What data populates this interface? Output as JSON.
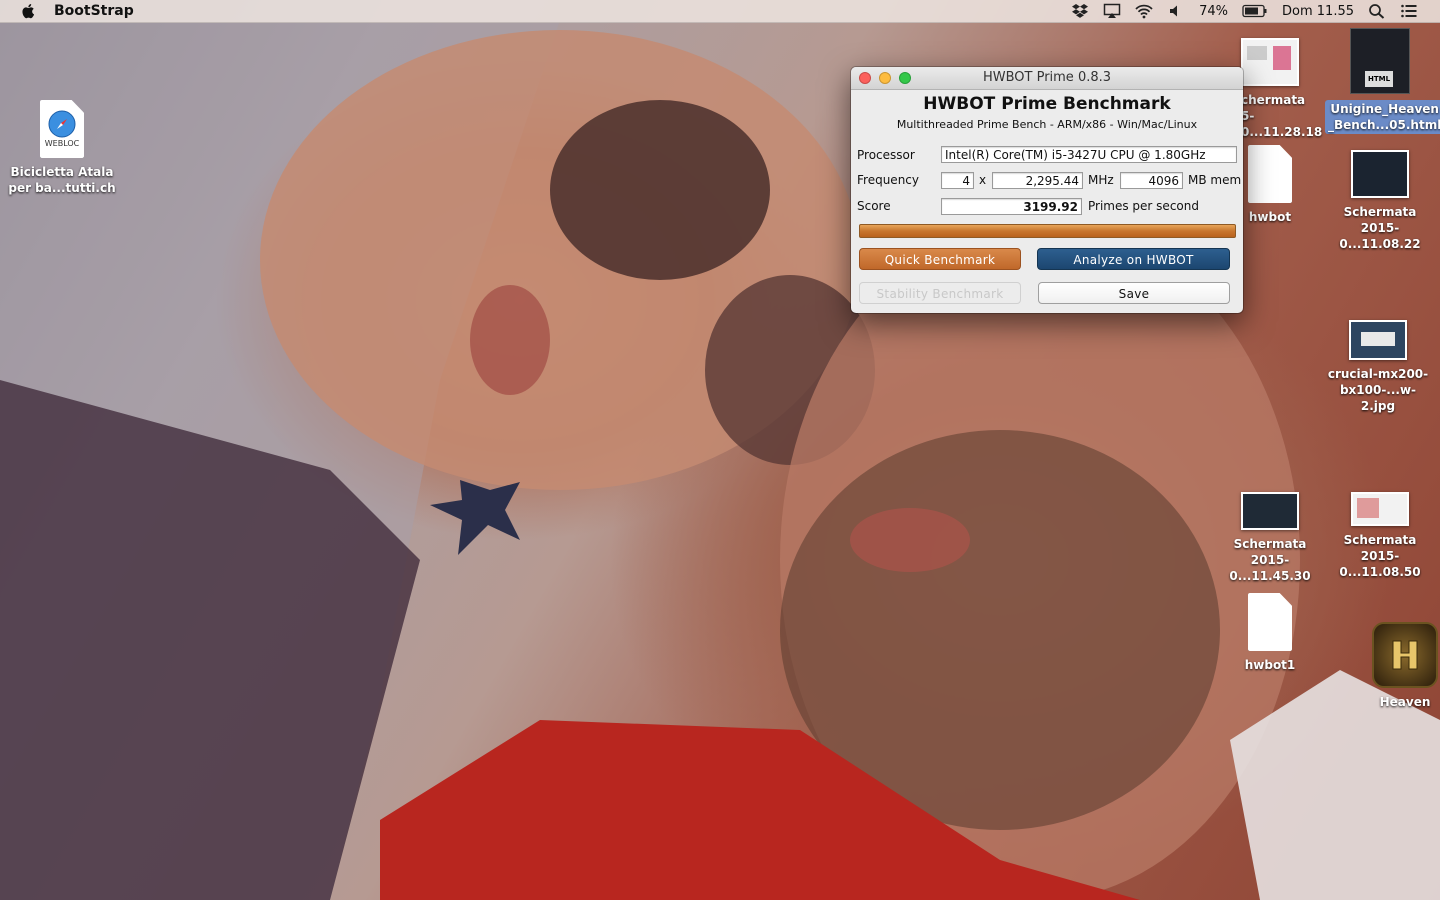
{
  "menubar": {
    "app_name": "BootStrap",
    "battery": "74%",
    "clock": "Dom 11.55",
    "icons": [
      "apple-icon",
      "dropbox-icon",
      "airplay-icon",
      "wifi-icon",
      "volume-icon",
      "battery-icon",
      "spotlight-icon",
      "notification-center-icon"
    ]
  },
  "desktop": {
    "icons": [
      {
        "label": "Bicicletta Atala\nper ba...tutti.ch",
        "badge": "WEBLOC"
      },
      {
        "label": "chermata\n5-0...11.28.18"
      },
      {
        "label": "Unigine_Heaven\n_Bench...05.html",
        "badge": "HTML"
      },
      {
        "label": "hwbot"
      },
      {
        "label": "Schermata\n2015-0...11.08.22"
      },
      {
        "label": "crucial-mx200-\nbx100-...w-2.jpg"
      },
      {
        "label": "Schermata\n2015-0...11.45.30"
      },
      {
        "label": "Schermata\n2015-0...11.08.50"
      },
      {
        "label": "hwbot1"
      },
      {
        "label": "Heaven"
      }
    ]
  },
  "window": {
    "title": "HWBOT Prime 0.8.3",
    "heading": "HWBOT Prime Benchmark",
    "subtitle": "Multithreaded Prime Bench - ARM/x86 - Win/Mac/Linux",
    "processor_label": "Processor",
    "processor_value": "Intel(R) Core(TM) i5-3427U CPU @ 1.80GHz",
    "frequency_label": "Frequency",
    "cores": "4",
    "times": "x",
    "frequency_value": "2,295.44",
    "mhz_unit": "MHz",
    "memory_value": "4096",
    "memory_unit": "MB mem",
    "score_label": "Score",
    "score_value": "3199.92",
    "score_unit": "Primes per second",
    "progress": 1.0,
    "buttons": {
      "quick": "Quick Benchmark",
      "analyze": "Analyze on HWBOT",
      "stability": "Stability Benchmark",
      "save": "Save"
    }
  },
  "colors": {
    "accent_orange": "#c8762e",
    "accent_blue": "#1f4a75"
  }
}
